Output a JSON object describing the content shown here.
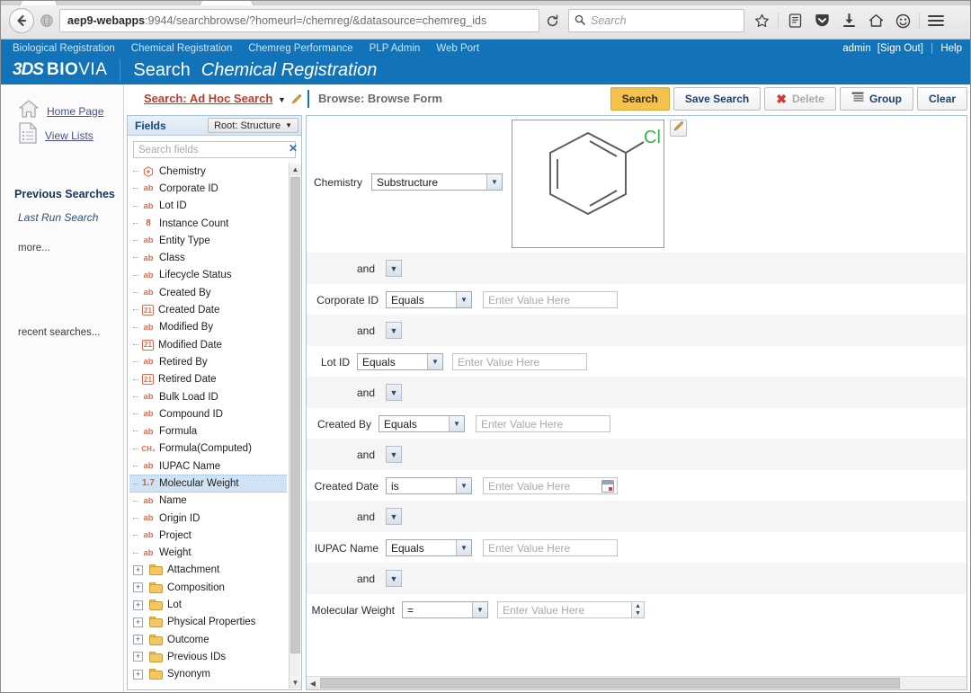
{
  "browser": {
    "back_icon": "back-arrow-icon",
    "site_icon": "globe-icon",
    "url_host": "aep9-webapps",
    "url_path": ":9944/searchbrowse/?homeurl=/chemreg/&datasource=chemreg_ids",
    "reload_icon": "reload-icon",
    "search_placeholder": "Search",
    "search_icon": "magnifier-icon",
    "icons": [
      "star-icon",
      "reader-icon",
      "pocket-icon",
      "download-icon",
      "home-icon",
      "smiley-icon",
      "hamburger-menu-icon"
    ]
  },
  "appbar": {
    "nav": [
      "Biological Registration",
      "Chemical Registration",
      "Chemreg Performance",
      "PLP Admin",
      "Web Port"
    ],
    "user": "admin",
    "signout": "[Sign Out]",
    "help": "Help",
    "brand_mark": "3DS",
    "brand_bold": "BIO",
    "brand_light": "VIA",
    "title": "Search",
    "subtitle": "Chemical Registration"
  },
  "leftnav": {
    "home_label": "Home Page",
    "lists_label": "View Lists",
    "previous_searches": "Previous Searches",
    "last_run": "Last Run Search",
    "more": "more...",
    "recent": "recent searches..."
  },
  "tabs": {
    "search_tab": "Search: Ad Hoc Search",
    "browse_tab": "Browse: Browse Form",
    "edit_icon": "pencil-icon",
    "caret_icon": "caret-down-icon"
  },
  "toolbar": {
    "search": "Search",
    "save_search": "Save Search",
    "delete": "Delete",
    "delete_icon": "x-icon",
    "group": "Group",
    "group_icon": "group-rows-icon",
    "clear": "Clear"
  },
  "fields_panel": {
    "title": "Fields",
    "root_label": "Root: Structure",
    "root_caret": "caret-down-icon",
    "search_placeholder": "Search fields",
    "clear_icon": "clear-x-icon",
    "scroll_up_icon": "chevron-up-icon",
    "scroll_down_icon": "chevron-down-icon",
    "items": [
      {
        "label": "Chemistry",
        "icon": "chemistry",
        "type": "leaf"
      },
      {
        "label": "Corporate ID",
        "icon": "ab",
        "type": "leaf"
      },
      {
        "label": "Lot ID",
        "icon": "ab",
        "type": "leaf"
      },
      {
        "label": "Instance Count",
        "icon": "8",
        "type": "leaf"
      },
      {
        "label": "Entity Type",
        "icon": "ab",
        "type": "leaf"
      },
      {
        "label": "Class",
        "icon": "ab",
        "type": "leaf"
      },
      {
        "label": "Lifecycle Status",
        "icon": "ab",
        "type": "leaf"
      },
      {
        "label": "Created By",
        "icon": "ab",
        "type": "leaf"
      },
      {
        "label": "Created Date",
        "icon": "21",
        "type": "leaf"
      },
      {
        "label": "Modified By",
        "icon": "ab",
        "type": "leaf"
      },
      {
        "label": "Modified Date",
        "icon": "21",
        "type": "leaf"
      },
      {
        "label": "Retired By",
        "icon": "ab",
        "type": "leaf"
      },
      {
        "label": "Retired Date",
        "icon": "21",
        "type": "leaf"
      },
      {
        "label": "Bulk Load ID",
        "icon": "ab",
        "type": "leaf"
      },
      {
        "label": "Compound ID",
        "icon": "ab",
        "type": "leaf"
      },
      {
        "label": "Formula",
        "icon": "ab",
        "type": "leaf"
      },
      {
        "label": "Formula(Computed)",
        "icon": "CH",
        "type": "leaf"
      },
      {
        "label": "IUPAC Name",
        "icon": "ab",
        "type": "leaf"
      },
      {
        "label": "Molecular Weight",
        "icon": "1.7",
        "type": "leaf",
        "selected": true
      },
      {
        "label": "Name",
        "icon": "ab",
        "type": "leaf"
      },
      {
        "label": "Origin ID",
        "icon": "ab",
        "type": "leaf"
      },
      {
        "label": "Project",
        "icon": "ab",
        "type": "leaf"
      },
      {
        "label": "Weight",
        "icon": "ab",
        "type": "leaf"
      },
      {
        "label": "Attachment",
        "icon": "folder",
        "type": "folder"
      },
      {
        "label": "Composition",
        "icon": "folder",
        "type": "folder"
      },
      {
        "label": "Lot",
        "icon": "folder",
        "type": "folder"
      },
      {
        "label": "Physical Properties",
        "icon": "folder",
        "type": "folder"
      },
      {
        "label": "Outcome",
        "icon": "folder",
        "type": "folder"
      },
      {
        "label": "Previous IDs",
        "icon": "folder",
        "type": "folder"
      },
      {
        "label": "Synonym",
        "icon": "folder",
        "type": "folder"
      }
    ]
  },
  "form": {
    "connector_label": "and",
    "connector_icon": "caret-down-icon",
    "value_placeholder": "Enter Value Here",
    "structure": {
      "label": "Chemistry",
      "operator": "Substructure",
      "molecule_atom_label": "Cl",
      "molecule_atom_color": "#3cb44b",
      "edit_icon": "pencil-icon"
    },
    "rows": [
      {
        "label": "Corporate ID",
        "operator": "Equals",
        "value": "",
        "widget": "text"
      },
      {
        "label": "Lot ID",
        "operator": "Equals",
        "value": "",
        "widget": "text"
      },
      {
        "label": "Created By",
        "operator": "Equals",
        "value": "",
        "widget": "text"
      },
      {
        "label": "Created Date",
        "operator": "is",
        "value": "",
        "widget": "date",
        "date_icon": "calendar-icon"
      },
      {
        "label": "IUPAC Name",
        "operator": "Equals",
        "value": "",
        "widget": "text"
      },
      {
        "label": "Molecular Weight",
        "operator": "=",
        "value": "",
        "widget": "number",
        "spin_up": "caret-up-icon",
        "spin_down": "caret-down-icon"
      }
    ],
    "hscroll_left_icon": "chevron-left-icon"
  },
  "colors": {
    "app_blue": "#1273b8",
    "accent_yellow": "#f2c14e",
    "tab_red": "#c0392b",
    "select_blue": "#cfe3f5"
  }
}
